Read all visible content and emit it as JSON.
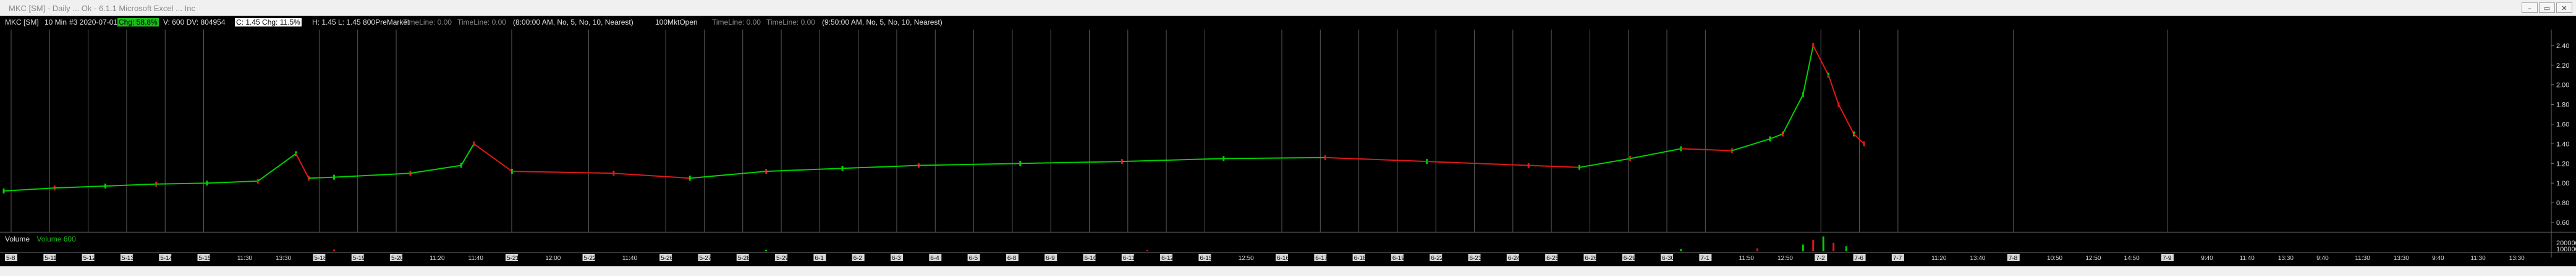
{
  "window": {
    "title": "MKC [SM]  - Daily ...  Ok  - 6.1.1 Microsoft Excel ... Inc",
    "minimize": "–",
    "restore": "▭",
    "close": "✕"
  },
  "info": {
    "symbol": "MKC [SM]",
    "interval": "10 Min",
    "date_label": "#3 2020-07-01",
    "change_badge": "Chg: 58.8%",
    "volume_text": "V: 600 DV: 804954",
    "close_badge": "C: 1.45 Chg: 11.5%",
    "hl_text": "H: 1.45 L: 1.45 800PreMarket",
    "tl1": "TimeLine: 0.00",
    "tl2": "TimeLine: 0.00",
    "nearest1": "(8:00:00 AM, No, 5, No, 10, Nearest)",
    "open_text": "100MktOpen",
    "tl3": "TimeLine: 0.00",
    "tl4": "TimeLine: 0.00",
    "nearest2": "(9:50:00 AM, No, 5, No, 10, Nearest)"
  },
  "colors": {
    "up": "#00d100",
    "down": "#e01818",
    "grid": "#5a5a5a",
    "accent_green": "#1db91d"
  },
  "volume": {
    "label": "Volume",
    "value_label": "Volume 600"
  },
  "price_axis": {
    "ticks": [
      "2.40",
      "2.20",
      "2.00",
      "1.80",
      "1.60",
      "1.40",
      "1.20",
      "1.00",
      "0.80",
      "0.60"
    ]
  },
  "volume_axis": {
    "ticks": [
      "200000",
      "100000"
    ]
  },
  "time_axis": {
    "labels": [
      "5-8",
      "5-11",
      "5-12",
      "5-13",
      "5-14",
      "5-15",
      "11:30",
      "13:30",
      "5-18",
      "5-19",
      "5-20",
      "11:20",
      "11:40",
      "5-21",
      "12:00",
      "5-22",
      "11:40",
      "5-26",
      "5-27",
      "5-28",
      "5-29",
      "6-1",
      "6-2",
      "6-3",
      "6-4",
      "6-5",
      "6-8",
      "6-9",
      "6-10",
      "6-11",
      "6-12",
      "6-15",
      "12:50",
      "6-16",
      "6-17",
      "6-18",
      "6-19",
      "6-22",
      "6-23",
      "6-24",
      "6-25",
      "6-26",
      "6-29",
      "6-30",
      "7-1",
      "11:50",
      "12:50",
      "7-2",
      "7-6",
      "7-7",
      "11:20",
      "13:40",
      "7-8",
      "10:50",
      "12:50",
      "14:50",
      "7-9",
      "9:40",
      "11:40",
      "13:30",
      "9:40",
      "11:30",
      "13:30",
      "9:40",
      "11:30",
      "13:30"
    ]
  },
  "chart_data": {
    "type": "candlestick",
    "timeframe": "10 Min",
    "ylim": [
      0.6,
      2.5
    ],
    "price": {
      "segments": [
        [
          0.0,
          0.92
        ],
        [
          0.02,
          0.95
        ],
        [
          0.04,
          0.97
        ],
        [
          0.06,
          0.99
        ],
        [
          0.08,
          1.0
        ],
        [
          0.1,
          1.02
        ],
        [
          0.12,
          1.05
        ],
        [
          0.115,
          1.3
        ],
        [
          0.13,
          1.06
        ],
        [
          0.16,
          1.1
        ],
        [
          0.18,
          1.18
        ],
        [
          0.185,
          1.4
        ],
        [
          0.2,
          1.12
        ],
        [
          0.24,
          1.1
        ],
        [
          0.27,
          1.05
        ],
        [
          0.3,
          1.12
        ],
        [
          0.33,
          1.15
        ],
        [
          0.36,
          1.18
        ],
        [
          0.4,
          1.2
        ],
        [
          0.44,
          1.22
        ],
        [
          0.48,
          1.25
        ],
        [
          0.52,
          1.26
        ],
        [
          0.56,
          1.22
        ],
        [
          0.6,
          1.18
        ],
        [
          0.62,
          1.16
        ],
        [
          0.64,
          1.25
        ],
        [
          0.66,
          1.35
        ],
        [
          0.68,
          1.33
        ],
        [
          0.695,
          1.45
        ],
        [
          0.7,
          1.5
        ],
        [
          0.708,
          1.9
        ],
        [
          0.712,
          2.4
        ],
        [
          0.718,
          2.1
        ],
        [
          0.722,
          1.8
        ],
        [
          0.728,
          1.5
        ],
        [
          0.732,
          1.4
        ]
      ]
    },
    "volume": {
      "ylim": [
        0,
        300000
      ],
      "bars": [
        [
          0.708,
          120000
        ],
        [
          0.712,
          200000
        ],
        [
          0.716,
          260000
        ],
        [
          0.72,
          150000
        ],
        [
          0.725,
          90000
        ],
        [
          0.13,
          30000
        ],
        [
          0.3,
          25000
        ],
        [
          0.45,
          22000
        ],
        [
          0.66,
          40000
        ],
        [
          0.69,
          50000
        ]
      ]
    }
  }
}
